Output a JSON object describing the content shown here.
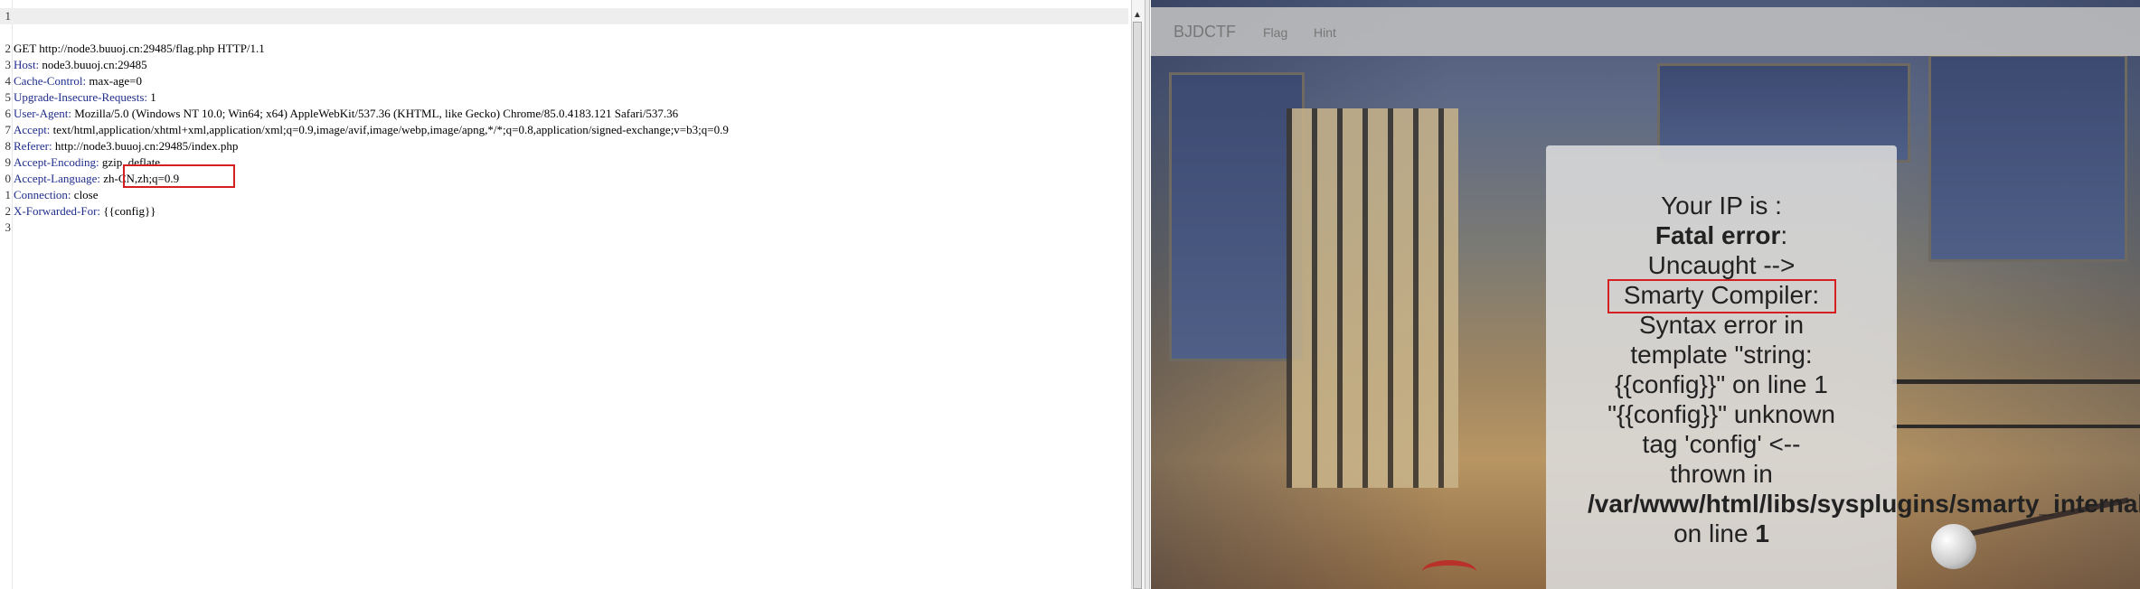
{
  "request": {
    "lines": [
      {
        "num": "1",
        "name": "",
        "value": "GET http://node3.buuoj.cn:29485/flag.php HTTP/1.1"
      },
      {
        "num": "2",
        "name": "Host:",
        "value": " node3.buuoj.cn:29485"
      },
      {
        "num": "3",
        "name": "Cache-Control:",
        "value": " max-age=0"
      },
      {
        "num": "4",
        "name": "Upgrade-Insecure-Requests:",
        "value": " 1"
      },
      {
        "num": "5",
        "name": "User-Agent:",
        "value": " Mozilla/5.0 (Windows NT 10.0; Win64; x64) AppleWebKit/537.36 (KHTML, like Gecko) Chrome/85.0.4183.121 Safari/537.36"
      },
      {
        "num": "6",
        "name": "Accept:",
        "value": " text/html,application/xhtml+xml,application/xml;q=0.9,image/avif,image/webp,image/apng,*/*;q=0.8,application/signed-exchange;v=b3;q=0.9"
      },
      {
        "num": "7",
        "name": "Referer:",
        "value": " http://node3.buuoj.cn:29485/index.php"
      },
      {
        "num": "8",
        "name": "Accept-Encoding:",
        "value": " gzip, deflate"
      },
      {
        "num": "9",
        "name": "Accept-Language:",
        "value": " zh-CN,zh;q=0.9"
      },
      {
        "num": "0",
        "name": "Connection:",
        "value": " close"
      },
      {
        "num": "1",
        "name": "X-Forwarded-For:",
        "value": " {{config}}"
      },
      {
        "num": "2",
        "name": "",
        "value": ""
      },
      {
        "num": "3",
        "name": "",
        "value": ""
      }
    ]
  },
  "response": {
    "nav": {
      "brand": "BJDCTF",
      "links": [
        "Flag",
        "Hint"
      ]
    },
    "card": {
      "line1": "Your IP is :",
      "fatal_bold": "Fatal error",
      "fatal_colon": ":",
      "line3": "Uncaught -->",
      "line4": "Smarty Compiler:",
      "line5": "Syntax error in",
      "line6": "template \"string:",
      "line7": "{{config}}\" on line 1",
      "line8": "\"{{config}}\" unknown",
      "line9": "tag 'config' <--",
      "line10": "thrown in",
      "path": "/var/www/html/libs/sysplugins/smarty_internal_templatecompilerbase.php",
      "line12_pre": "on line ",
      "line12_num": "1"
    }
  },
  "colors": {
    "header_name": "#1f2d8c",
    "highlight": "#d42020"
  }
}
